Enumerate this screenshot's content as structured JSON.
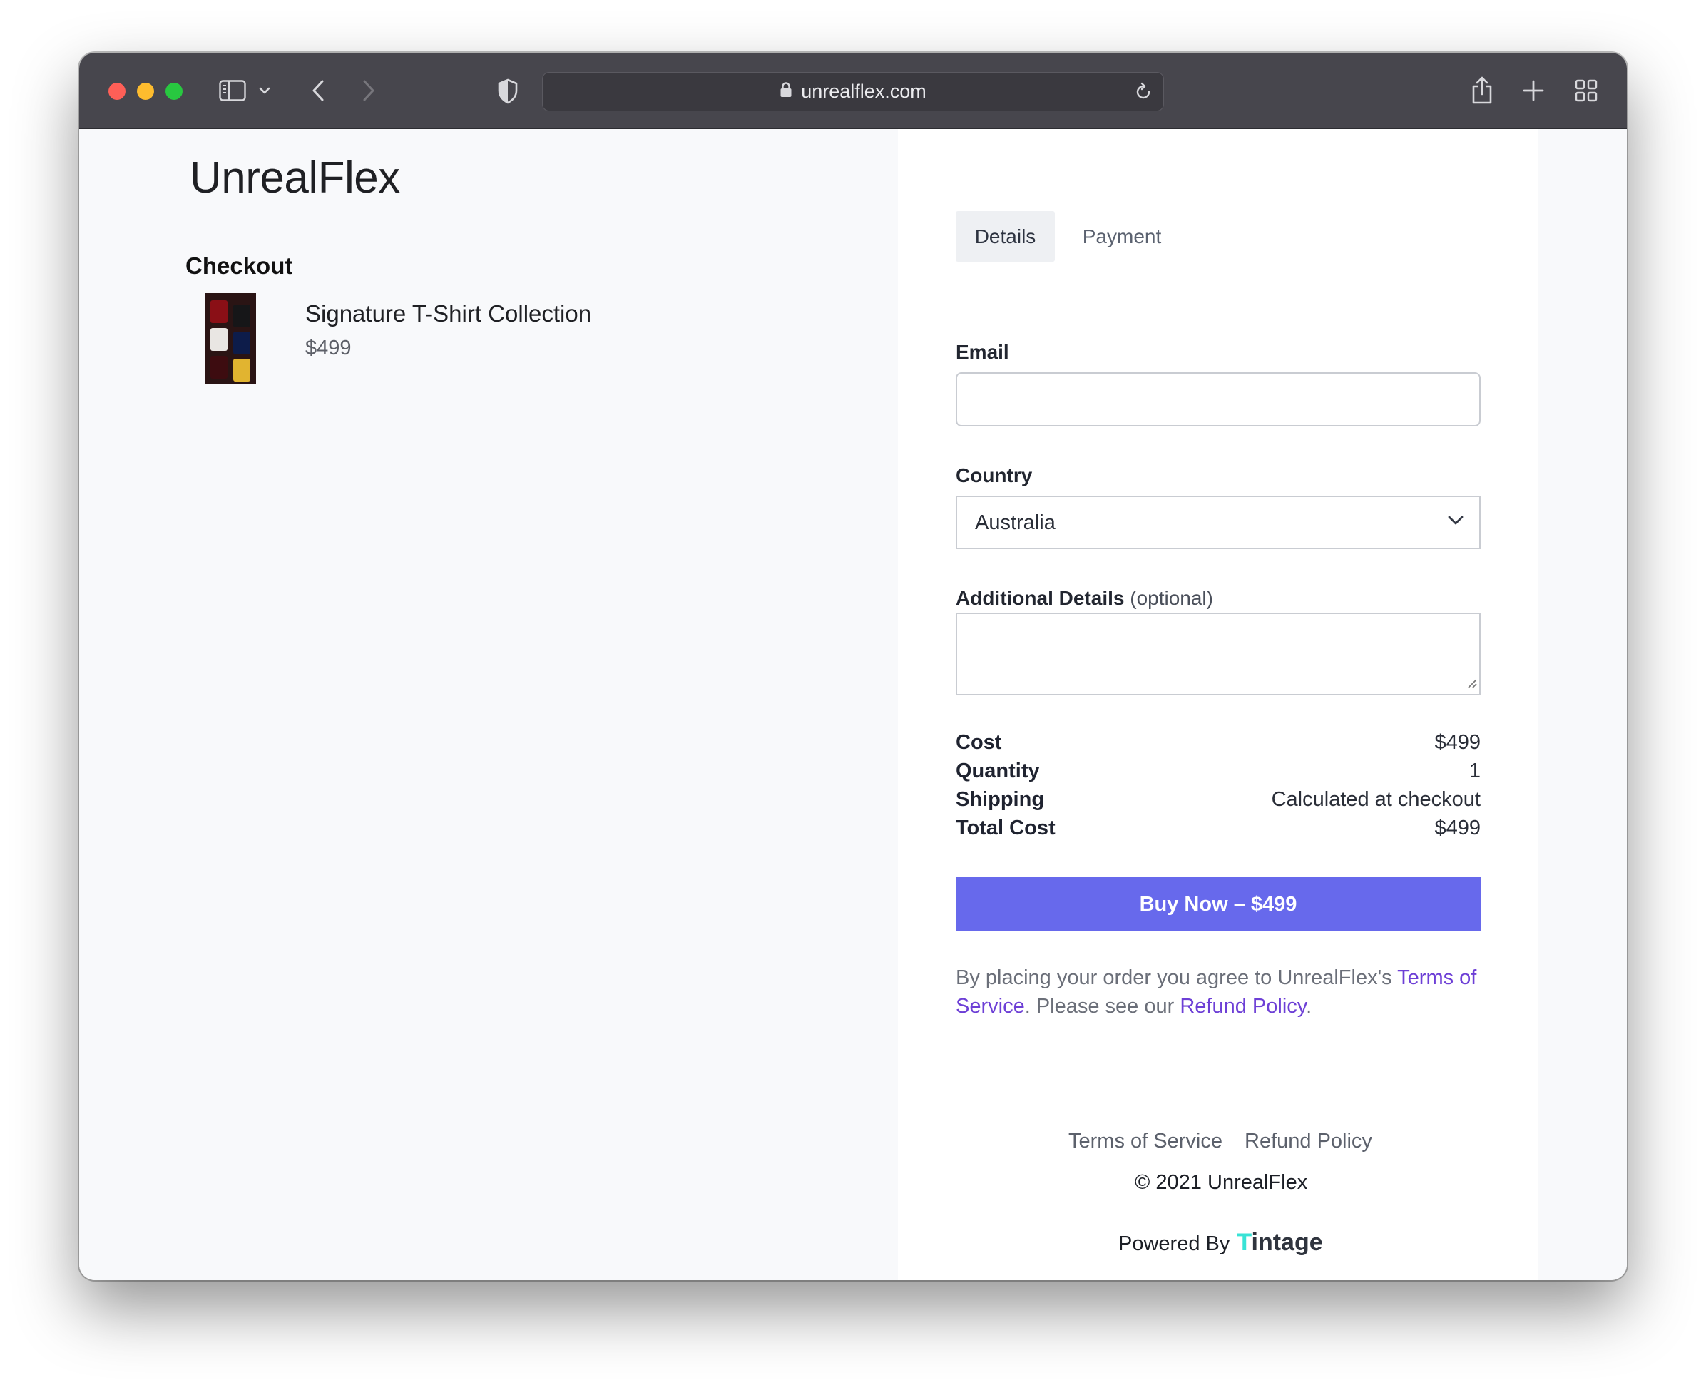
{
  "browser": {
    "url": "unrealflex.com"
  },
  "store": {
    "brand": "UnrealFlex",
    "checkout_title": "Checkout"
  },
  "product": {
    "name": "Signature T-Shirt Collection",
    "price": "$499"
  },
  "tabs": [
    {
      "label": "Details",
      "active": true
    },
    {
      "label": "Payment",
      "active": false
    }
  ],
  "form": {
    "email_label": "Email",
    "email_value": "",
    "country_label": "Country",
    "country_value": "Australia",
    "additional_label": "Additional Details",
    "additional_optional": "(optional)",
    "additional_value": ""
  },
  "summary": [
    {
      "label": "Cost",
      "value": "$499"
    },
    {
      "label": "Quantity",
      "value": "1"
    },
    {
      "label": "Shipping",
      "value": "Calculated at checkout"
    },
    {
      "label": "Total Cost",
      "value": "$499"
    }
  ],
  "buy_button": "Buy Now – $499",
  "agreement": {
    "prefix": "By placing your order you agree to UnrealFlex's ",
    "tos_link": "Terms of Service",
    "middle": ". Please see our ",
    "refund_link": "Refund Policy",
    "suffix": "."
  },
  "footer": {
    "terms": "Terms of Service",
    "refund": "Refund Policy",
    "copyright": "© 2021 UnrealFlex",
    "powered_by": "Powered By",
    "provider_first": "T",
    "provider_rest": "intage"
  },
  "colors": {
    "accent": "#6769ec",
    "link": "#6d3fd6",
    "provider_accent": "#38e3d6"
  }
}
